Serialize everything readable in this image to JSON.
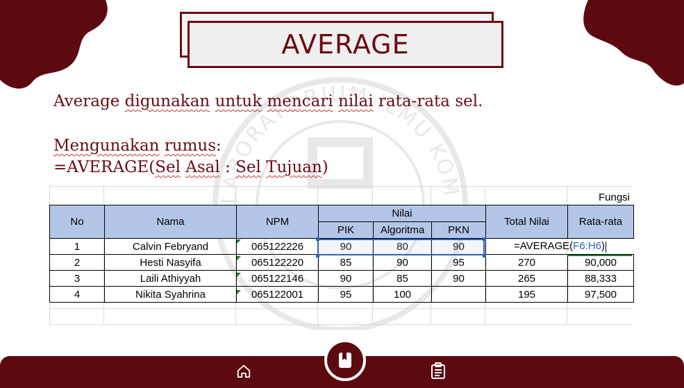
{
  "slide": {
    "title": "AVERAGE",
    "description": {
      "w1": "Average",
      "w2": "digunakan",
      "w3": "untuk",
      "w4": "mencari",
      "w5": "nilai",
      "w6": "rata-rata sel."
    },
    "rumus": {
      "label_w1": "Mengunakan",
      "label_w2": "rumus",
      "label_colon": ":",
      "f1": "=AVERAGE(",
      "f2": "Sel",
      "f3": "Asal",
      "f4": " : ",
      "f5": "Sel",
      "f6": "Tujuan",
      "f7": ")"
    }
  },
  "spreadsheet": {
    "fungsi_label": "Fungsi",
    "headers": {
      "no": "No",
      "nama": "Nama",
      "npm": "NPM",
      "nilai": "Nilai",
      "pik": "PIK",
      "algoritma": "Algoritma",
      "pkn": "PKN",
      "total": "Total Nilai",
      "rata": "Rata-rata"
    },
    "rows": [
      {
        "no": "1",
        "nama": "Calvin Febryand",
        "npm": "065122226",
        "pik": "90",
        "algoritma": "80",
        "pkn": "90",
        "total": "",
        "rata": ""
      },
      {
        "no": "2",
        "nama": "Hesti Nasyifa",
        "npm": "065122220",
        "pik": "85",
        "algoritma": "90",
        "pkn": "95",
        "total": "270",
        "rata": "90,000"
      },
      {
        "no": "3",
        "nama": "Laili Athiyyah",
        "npm": "065122146",
        "pik": "90",
        "algoritma": "85",
        "pkn": "90",
        "total": "265",
        "rata": "88,333"
      },
      {
        "no": "4",
        "nama": "Nikita Syahrina",
        "npm": "065122001",
        "pik": "95",
        "algoritma": "100",
        "pkn": "",
        "total": "195",
        "rata": "97,500"
      }
    ],
    "editing_formula": {
      "prefix": "=AVERAGE(",
      "ref": "F6:H6",
      "suffix": ")"
    }
  },
  "watermark": {
    "text": "LABORATORIUM ILMU KOMPUTER"
  },
  "colors": {
    "brand": "#6b0a12",
    "bar": "#5c0a10",
    "header_fill": "#b4c6e7",
    "selection": "#2e62b7"
  },
  "nav": {
    "left_icon": "home-icon",
    "center_icon": "book-icon",
    "right_icon": "clipboard-icon"
  }
}
